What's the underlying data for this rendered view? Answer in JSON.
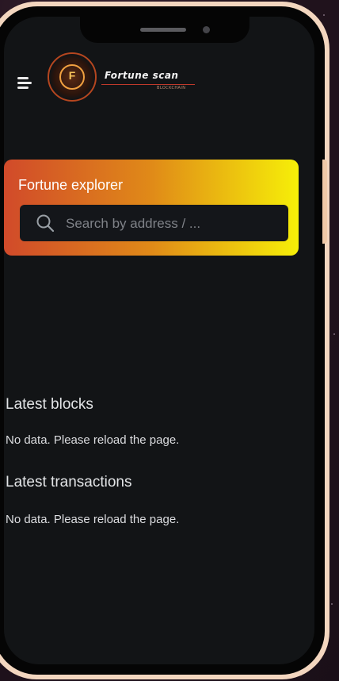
{
  "header": {
    "menu_icon": "hamburger-menu-icon",
    "logo": {
      "emblem_letter": "F",
      "brand_name": "Fortune scan",
      "tagline": "BLOCKCHAIN"
    }
  },
  "banner": {
    "title": "Fortune explorer",
    "search": {
      "icon": "search-icon",
      "placeholder": "Search by address / ..."
    },
    "gradient": [
      "#d14a2a",
      "#e08a18",
      "#f6ef08"
    ]
  },
  "latest_blocks": {
    "heading": "Latest blocks",
    "empty_message": "No data. Please reload the page."
  },
  "latest_transactions": {
    "heading": "Latest transactions",
    "empty_message": "No data. Please reload the page."
  },
  "colors": {
    "screen_background": "#121416",
    "frame": "#f3d6bf",
    "search_background": "#14161a"
  }
}
